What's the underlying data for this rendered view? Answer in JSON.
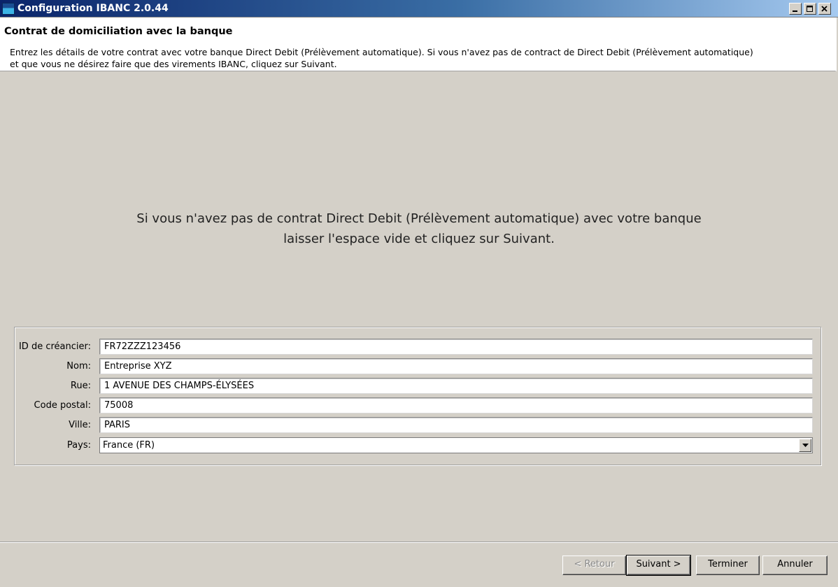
{
  "window": {
    "title": "Configuration IBANC 2.0.44",
    "icons": [
      "app-icon",
      "minimize-icon",
      "maximize-icon",
      "close-icon"
    ]
  },
  "header": {
    "title": "Contrat de domiciliation avec la banque",
    "description": "Entrez les détails de votre contrat avec votre banque Direct Debit (Prélèvement automatique). Si vous n'avez pas de contract de Direct Debit (Prélèvement automatique)\n et que vous ne désirez faire que des virements IBANC, cliquez sur Suivant."
  },
  "info": {
    "line1": "Si vous n'avez pas de contrat Direct Debit (Prélèvement automatique) avec votre banque",
    "line2": "laisser l'espace vide et cliquez sur Suivant."
  },
  "form": {
    "creditor_id": {
      "label": "ID de créancier:",
      "value": "FR72ZZZ123456"
    },
    "name": {
      "label": "Nom:",
      "value": "Entreprise XYZ"
    },
    "street": {
      "label": "Rue:",
      "value": "1 AVENUE DES CHAMPS-ÉLYSÉES"
    },
    "postal_code": {
      "label": "Code postal:",
      "value": "75008"
    },
    "city": {
      "label": "Ville:",
      "value": "PARIS"
    },
    "country": {
      "label": "Pays:",
      "value": "France (FR)"
    }
  },
  "buttons": {
    "back": "< Retour",
    "next": "Suivant >",
    "finish": "Terminer",
    "cancel": "Annuler"
  }
}
